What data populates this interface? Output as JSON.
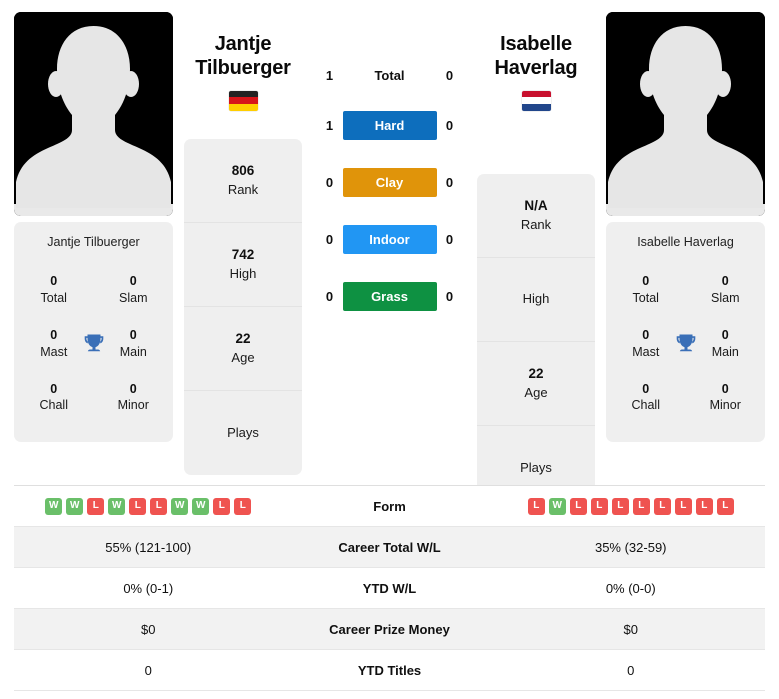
{
  "players": {
    "left": {
      "name": "Jantje Tilbuerger",
      "name_line1": "Jantje",
      "name_line2": "Tilbuerger",
      "flag_name": "germany-flag",
      "flag_colors": [
        "#222222",
        "#d7141a",
        "#ffce00"
      ],
      "photo_alt": "player-silhouette",
      "titles": [
        {
          "label": "Total",
          "value": "0"
        },
        {
          "label": "Slam",
          "value": "0"
        },
        {
          "label": "Mast",
          "value": "0"
        },
        {
          "label": "Main",
          "value": "0"
        },
        {
          "label": "Chall",
          "value": "0"
        },
        {
          "label": "Minor",
          "value": "0"
        }
      ],
      "rank_rows": [
        {
          "value": "806",
          "label": "Rank"
        },
        {
          "value": "742",
          "label": "High"
        },
        {
          "value": "22",
          "label": "Age"
        },
        {
          "value": "",
          "label": "Plays"
        }
      ],
      "form": [
        "W",
        "W",
        "L",
        "W",
        "L",
        "L",
        "W",
        "W",
        "L",
        "L"
      ]
    },
    "right": {
      "name": "Isabelle Haverlag",
      "name_line1": "Isabelle",
      "name_line2": "Haverlag",
      "flag_name": "netherlands-flag",
      "flag_colors": [
        "#c8102e",
        "#ffffff",
        "#21468b"
      ],
      "photo_alt": "player-silhouette",
      "titles": [
        {
          "label": "Total",
          "value": "0"
        },
        {
          "label": "Slam",
          "value": "0"
        },
        {
          "label": "Mast",
          "value": "0"
        },
        {
          "label": "Main",
          "value": "0"
        },
        {
          "label": "Chall",
          "value": "0"
        },
        {
          "label": "Minor",
          "value": "0"
        }
      ],
      "rank_rows": [
        {
          "value": "N/A",
          "label": "Rank"
        },
        {
          "value": "",
          "label": "High"
        },
        {
          "value": "22",
          "label": "Age"
        },
        {
          "value": "",
          "label": "Plays"
        }
      ],
      "form": [
        "L",
        "W",
        "L",
        "L",
        "L",
        "L",
        "L",
        "L",
        "L",
        "L"
      ]
    }
  },
  "head_to_head": [
    {
      "surface": "Total",
      "left": "1",
      "right": "0",
      "color": "",
      "text_color": "#101010",
      "plain": true
    },
    {
      "surface": "Hard",
      "left": "1",
      "right": "0",
      "color": "#0d6ebd",
      "text_color": "#ffffff",
      "plain": false
    },
    {
      "surface": "Clay",
      "left": "0",
      "right": "0",
      "color": "#e0940a",
      "text_color": "#ffffff",
      "plain": false
    },
    {
      "surface": "Indoor",
      "left": "0",
      "right": "0",
      "color": "#2196f3",
      "text_color": "#ffffff",
      "plain": false
    },
    {
      "surface": "Grass",
      "left": "0",
      "right": "0",
      "color": "#0e9142",
      "text_color": "#ffffff",
      "plain": false
    }
  ],
  "form_row_label": "Form",
  "stats_table": [
    {
      "label": "Career Total W/L",
      "left": "55% (121-100)",
      "right": "35% (32-59)"
    },
    {
      "label": "YTD W/L",
      "left": "0% (0-1)",
      "right": "0% (0-0)"
    },
    {
      "label": "Career Prize Money",
      "left": "$0",
      "right": "$0"
    },
    {
      "label": "YTD Titles",
      "left": "0",
      "right": "0"
    }
  ],
  "colors": {
    "win_badge": "#6abf69",
    "loss_badge": "#ef5350",
    "card_bg": "#efefef",
    "trophy": "#3a6fb7"
  }
}
